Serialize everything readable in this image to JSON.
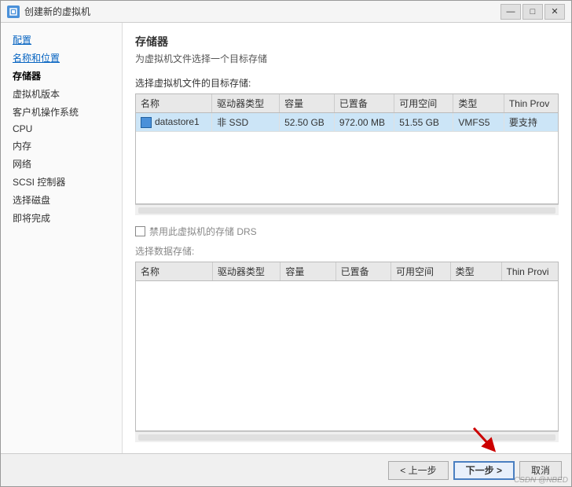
{
  "window": {
    "title": "创建新的虚拟机",
    "controls": {
      "minimize": "—",
      "maximize": "□",
      "close": "✕"
    }
  },
  "sidebar": {
    "items": [
      {
        "label": "配置",
        "state": "link"
      },
      {
        "label": "名称和位置",
        "state": "link"
      },
      {
        "label": "存储器",
        "state": "active"
      },
      {
        "label": "虚拟机版本",
        "state": "normal"
      },
      {
        "label": "客户机操作系统",
        "state": "normal"
      },
      {
        "label": "CPU",
        "state": "normal"
      },
      {
        "label": "内存",
        "state": "normal"
      },
      {
        "label": "网络",
        "state": "normal"
      },
      {
        "label": "SCSI 控制器",
        "state": "normal"
      },
      {
        "label": "选择磁盘",
        "state": "normal"
      },
      {
        "label": "即将完成",
        "state": "normal"
      }
    ]
  },
  "main": {
    "section_title": "存储器",
    "section_subtitle": "为虚拟机文件选择一个目标存储",
    "upper_table_label": "选择虚拟机文件的目标存储:",
    "upper_table": {
      "columns": [
        "名称",
        "驱动器类型",
        "容量",
        "已置备",
        "可用空间",
        "类型",
        "Thin Prov"
      ],
      "rows": [
        {
          "selected": true,
          "name": "datastore1",
          "driver_type": "非 SSD",
          "capacity": "52.50 GB",
          "provisioned": "972.00 MB",
          "available": "51.55 GB",
          "type": "VMFS5",
          "thin_prov": "要支持"
        }
      ]
    },
    "drs_checkbox_label": "禁用此虚拟机的存储 DRS",
    "lower_table_label": "选择数据存储:",
    "lower_table": {
      "columns": [
        "名称",
        "驱动器类型",
        "容量",
        "已置备",
        "可用空间",
        "类型",
        "Thin Provi"
      ],
      "rows": []
    }
  },
  "footer": {
    "back_label": "< 上一步",
    "next_label": "下一步 >",
    "cancel_label": "取消"
  },
  "watermark": "CSDN @NBED"
}
